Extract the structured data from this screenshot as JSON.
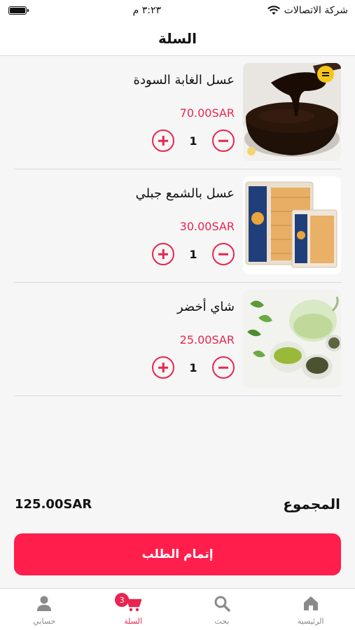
{
  "status_bar": {
    "carrier": "شركة الاتصالات",
    "time": "٣:٢٣ م"
  },
  "header": {
    "title": "السلة"
  },
  "cart": {
    "items": [
      {
        "name": "عسل الغابة السودة",
        "price": "70.00SAR",
        "quantity": "1",
        "image": "black-honey-spoon"
      },
      {
        "name": "عسل بالشمع جبلي",
        "price": "30.00SAR",
        "quantity": "1",
        "image": "honeycomb-boxes"
      },
      {
        "name": "شاي أخضر",
        "price": "25.00SAR",
        "quantity": "1",
        "image": "green-tea-pot"
      }
    ]
  },
  "summary": {
    "total_label": "المجموع",
    "total_value": "125.00SAR",
    "checkout_label": "إتمام الطلب"
  },
  "tab_bar": {
    "home": {
      "label": "الرئيسية",
      "icon": "home-icon"
    },
    "search": {
      "label": "بحث",
      "icon": "search-icon"
    },
    "cart": {
      "label": "السلة",
      "icon": "cart-icon",
      "badge": "3"
    },
    "account": {
      "label": "حسابي",
      "icon": "user-icon"
    }
  },
  "colors": {
    "accent": "#e8264f",
    "checkout": "#ff1e4c",
    "background": "#f6f6f6"
  }
}
